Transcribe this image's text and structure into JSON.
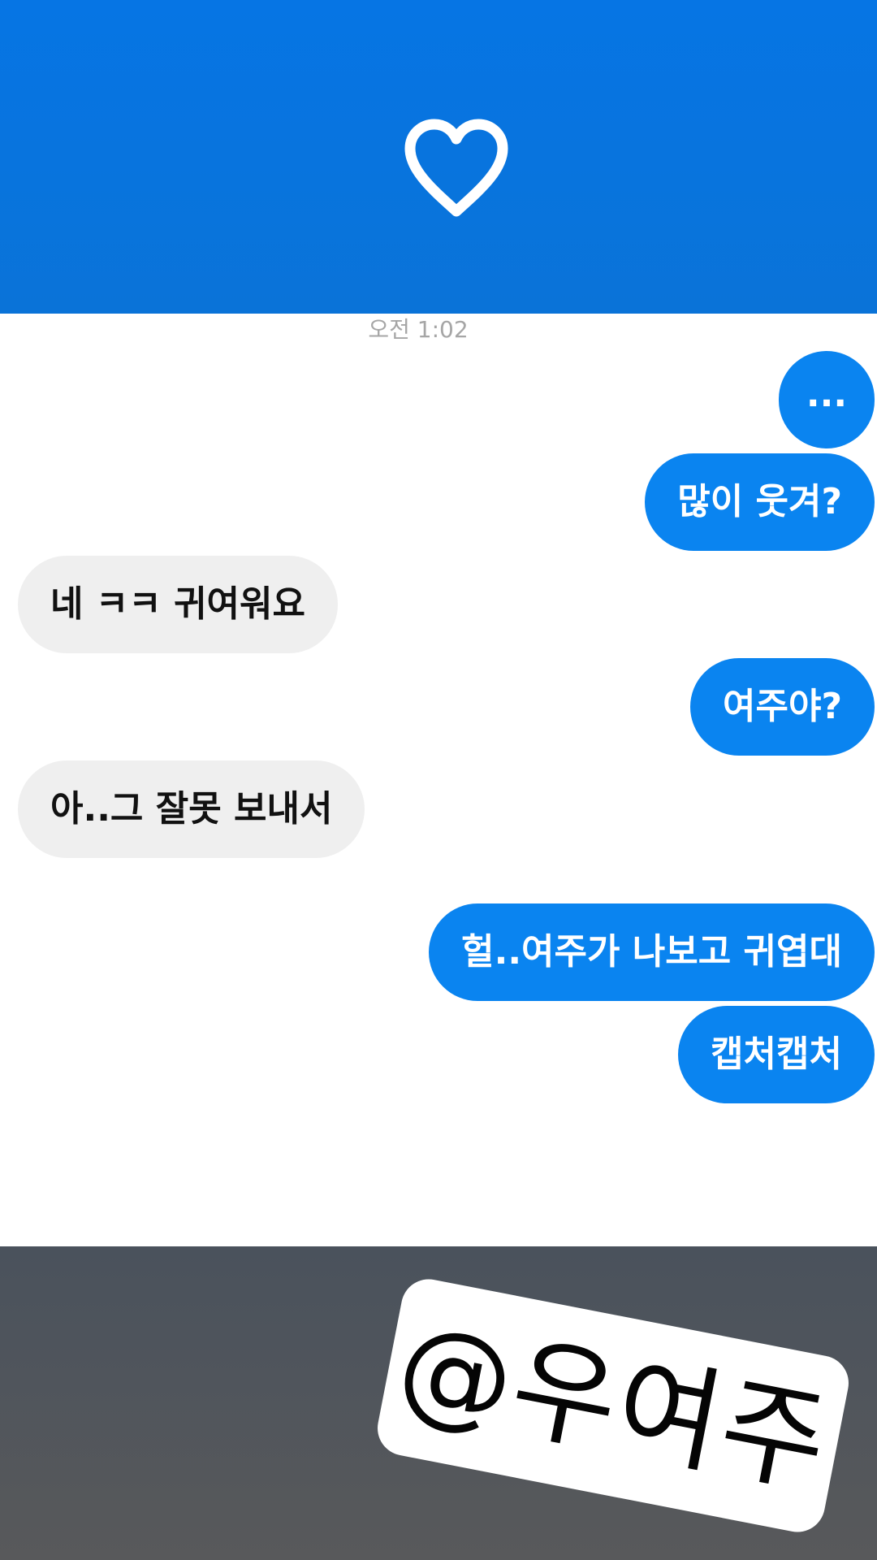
{
  "header": {
    "background": "#0675e4",
    "icon": "heart-outline-icon"
  },
  "chat": {
    "timestamp": "오전 1:02",
    "messages": [
      {
        "side": "out",
        "text": "..."
      },
      {
        "side": "out",
        "text": "많이 웃겨?"
      },
      {
        "side": "in",
        "text": "네 ㅋㅋ 귀여워요"
      },
      {
        "side": "out",
        "text": "여주야?"
      },
      {
        "side": "in",
        "text": "아..그 잘못 보내서"
      },
      {
        "side": "out",
        "text": "헐..여주가 나보고 귀엽대"
      },
      {
        "side": "out",
        "text": "캡처캡처"
      }
    ],
    "colors": {
      "outgoing": "#0a84f0",
      "incoming": "#efefef"
    }
  },
  "footer": {
    "background": "#4f555c",
    "sticker_text": "@우여주"
  }
}
